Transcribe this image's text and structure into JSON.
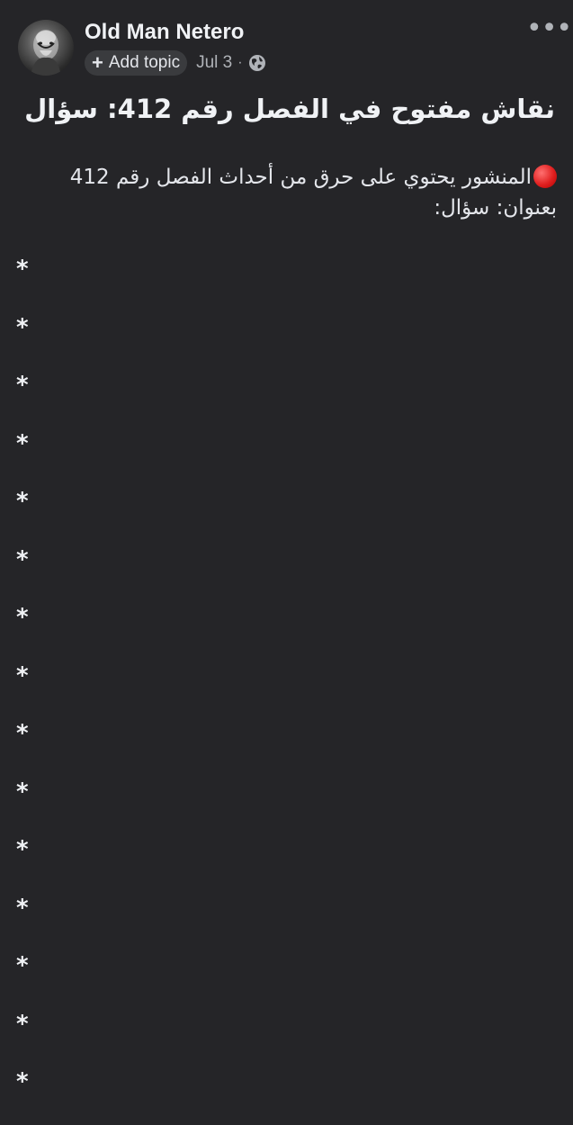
{
  "author": {
    "name": "Old Man Netero"
  },
  "meta": {
    "topic_label": "Add topic",
    "date": "Jul 3",
    "separator": "·"
  },
  "post": {
    "title": "نقاش مفتوح في الفصل رقم 412: سؤال",
    "body_line1": "المنشور يحتوي على حرق من أحداث الفصل رقم 412",
    "body_line2": "بعنوان: سؤال:",
    "spoiler_spacer": [
      "*",
      "*",
      "*",
      "*",
      "*",
      "*",
      "*",
      "*",
      "*",
      "*",
      "*",
      "*",
      "*",
      "*",
      "*"
    ]
  },
  "icons": {
    "avatar": "avatar-image",
    "plus": "plus-icon",
    "globe": "globe-icon",
    "more": "more-options-icon",
    "red_circle": "red-circle-emoji"
  },
  "colors": {
    "background": "#252528",
    "text": "#e4e6eb",
    "secondary_text": "#b0b3b8",
    "pill_background": "#3a3b3e",
    "red_circle": "#e02020"
  }
}
